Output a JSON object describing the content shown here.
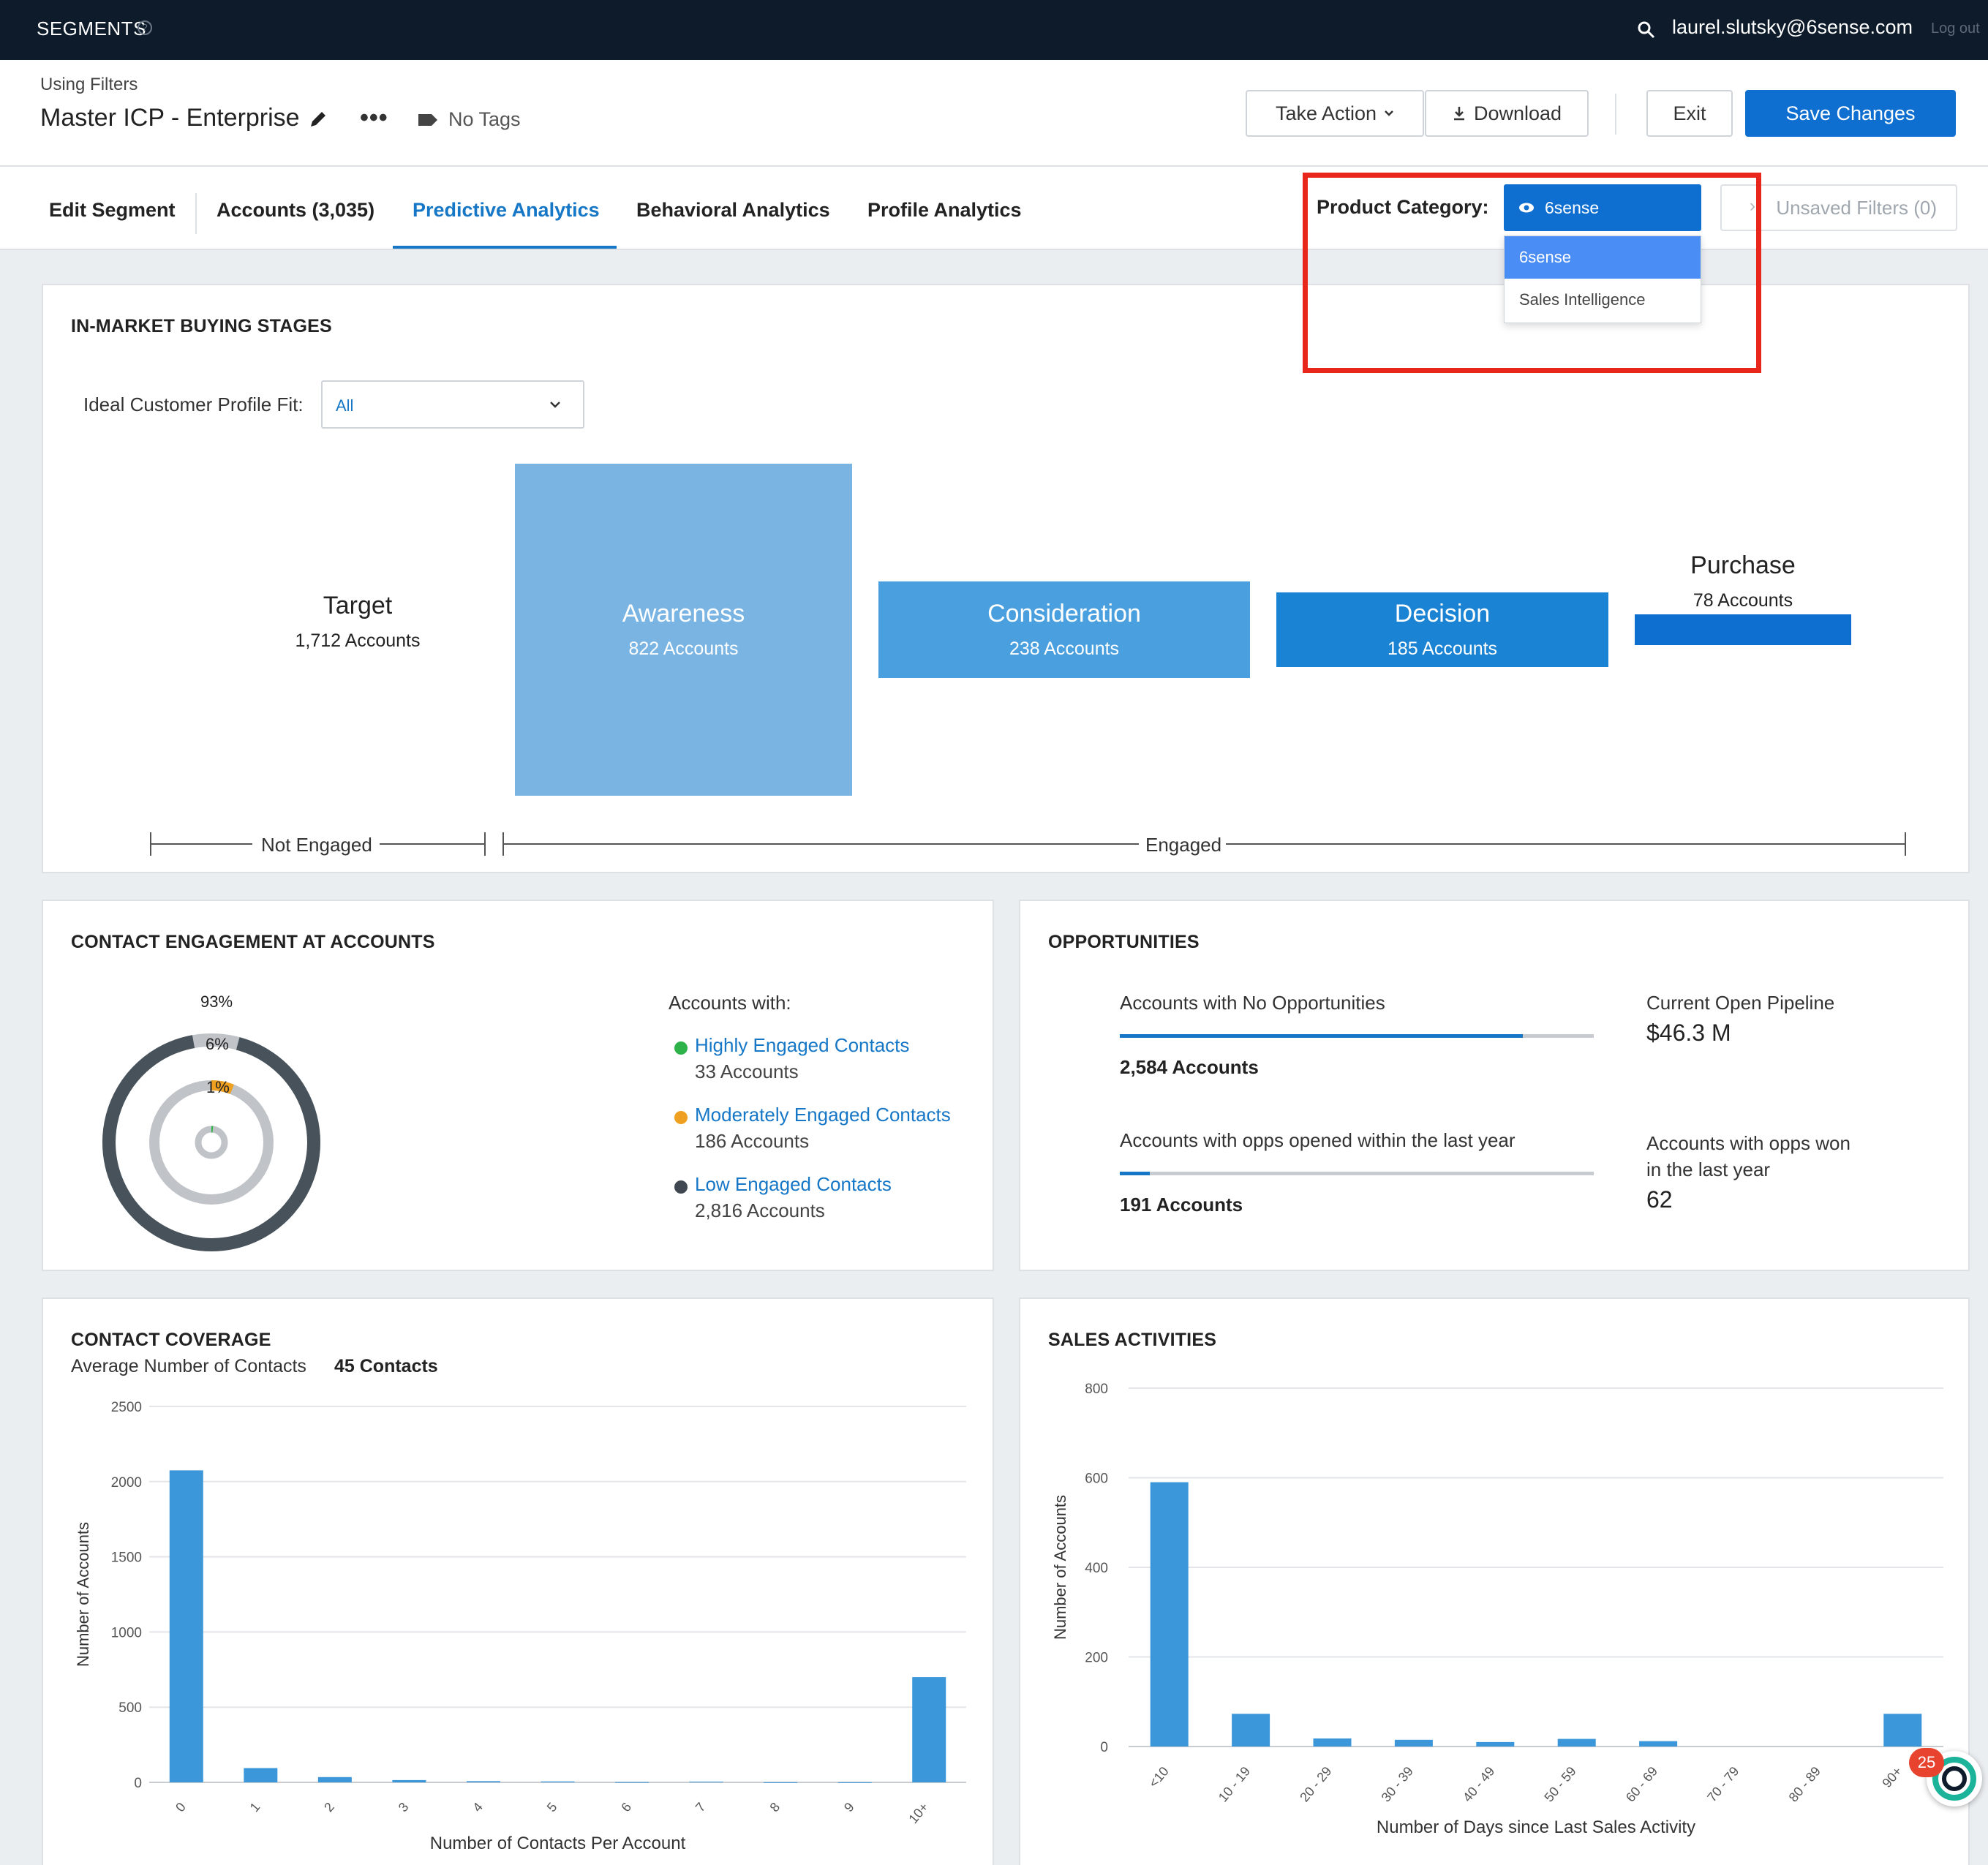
{
  "topbar": {
    "brand": "SEGMENTS",
    "help": "?",
    "email": "laurel.slutsky@6sense.com",
    "logout": "Log out"
  },
  "header": {
    "using_filters": "Using Filters",
    "segment_name": "Master ICP - Enterprise",
    "more": "•••",
    "tags": "No Tags",
    "take_action": "Take Action",
    "download": "Download",
    "exit": "Exit",
    "save": "Save Changes"
  },
  "tabs": {
    "items": [
      "Edit Segment",
      "Accounts (3,035)",
      "Predictive Analytics",
      "Behavioral Analytics",
      "Profile Analytics"
    ],
    "active": "Predictive Analytics"
  },
  "product_category": {
    "label": "Product Category:",
    "selected": "6sense",
    "options": [
      "6sense",
      "Sales Intelligence"
    ],
    "unsaved_filters": "Unsaved Filters (0)"
  },
  "buying_stages": {
    "title": "IN-MARKET BUYING STAGES",
    "icp_label": "Ideal Customer Profile Fit:",
    "icp_value": "All",
    "stages": [
      {
        "name": "Target",
        "count": "1,712 Accounts"
      },
      {
        "name": "Awareness",
        "count": "822 Accounts"
      },
      {
        "name": "Consideration",
        "count": "238 Accounts"
      },
      {
        "name": "Decision",
        "count": "185 Accounts"
      },
      {
        "name": "Purchase",
        "count": "78 Accounts"
      }
    ],
    "not_engaged": "Not Engaged",
    "engaged": "Engaged"
  },
  "contact_engagement": {
    "title": "CONTACT ENGAGEMENT AT ACCOUNTS",
    "ring_labels": [
      "93%",
      "6%",
      "1%"
    ],
    "accounts_with": "Accounts with:",
    "items": [
      {
        "label": "Highly Engaged Contacts",
        "count": "33 Accounts",
        "color": "#2db34a"
      },
      {
        "label": "Moderately Engaged Contacts",
        "count": "186 Accounts",
        "color": "#f0a020"
      },
      {
        "label": "Low Engaged Contacts",
        "count": "2,816 Accounts",
        "color": "#3f4850"
      }
    ]
  },
  "opportunities": {
    "title": "OPPORTUNITIES",
    "no_opps_label": "Accounts with No Opportunities",
    "no_opps_value": "2,584 Accounts",
    "no_opps_fraction": 0.85,
    "opened_label": "Accounts with opps opened within the last year",
    "opened_value": "191 Accounts",
    "opened_fraction": 0.063,
    "pipeline_label": "Current Open Pipeline",
    "pipeline_value": "$46.3 M",
    "won_label_1": "Accounts with opps won",
    "won_label_2": "in the last year",
    "won_value": "62"
  },
  "contact_coverage": {
    "title": "CONTACT COVERAGE",
    "avg_label": "Average Number of Contacts",
    "avg_value": "45 Contacts"
  },
  "sales_activities": {
    "title": "SALES ACTIVITIES"
  },
  "notification": {
    "count": "25"
  },
  "chart_data": [
    {
      "type": "bar",
      "title": "CONTACT COVERAGE",
      "categories": [
        "0",
        "1",
        "2",
        "3",
        "4",
        "5",
        "6",
        "7",
        "8",
        "9",
        "10+"
      ],
      "values": [
        2075,
        95,
        35,
        15,
        8,
        6,
        2,
        5,
        1,
        1,
        700
      ],
      "xlabel": "Number of Contacts Per Account",
      "ylabel": "Number of Accounts",
      "yticks": [
        0,
        500,
        1000,
        1500,
        2000,
        2500
      ],
      "ylim": [
        0,
        2500
      ],
      "color": "#3b97da",
      "grid": true
    },
    {
      "type": "bar",
      "title": "SALES ACTIVITIES",
      "categories": [
        "<10",
        "10 - 19",
        "20 - 29",
        "30 - 39",
        "40 - 49",
        "50 - 59",
        "60 - 69",
        "70 - 79",
        "80 - 89",
        "90+"
      ],
      "values": [
        590,
        73,
        18,
        15,
        10,
        17,
        12,
        0,
        0,
        73
      ],
      "xlabel": "Number of Days since Last Sales Activity",
      "ylabel": "Number of Accounts",
      "yticks": [
        0,
        200,
        400,
        600,
        800
      ],
      "ylim": [
        0,
        800
      ],
      "color": "#3b97da",
      "grid": true
    }
  ]
}
